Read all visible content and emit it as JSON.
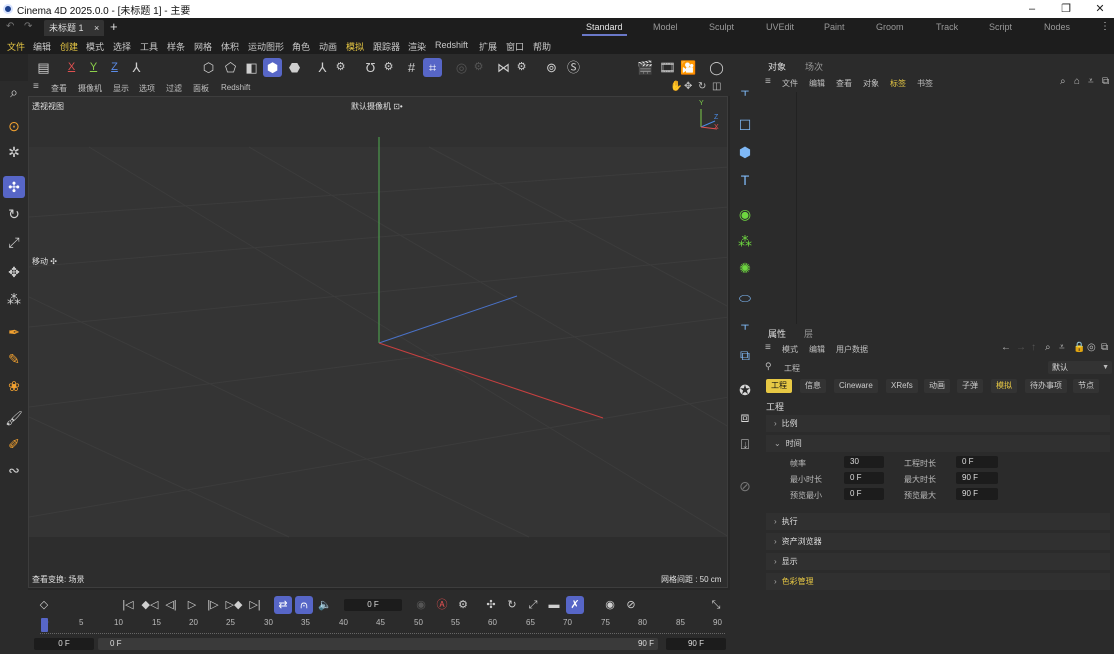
{
  "window": {
    "title": "Cinema 4D 2025.0.0 - [未标题 1] - 主要",
    "minimize": "–",
    "maximize": "❐",
    "close": "✕"
  },
  "tabs": {
    "doc_tab": "未标题 1",
    "close": "×",
    "add": "+"
  },
  "layouts": [
    "Standard",
    "Model",
    "Sculpt",
    "UVEdit",
    "Paint",
    "Groom",
    "Track",
    "Script",
    "Nodes"
  ],
  "active_layout": "Standard",
  "menu": [
    "文件",
    "编辑",
    "创建",
    "模式",
    "选择",
    "工具",
    "样条",
    "网格",
    "体积",
    "运动图形",
    "角色",
    "动画",
    "模拟",
    "跟踪器",
    "渲染",
    "Redshift",
    "扩展",
    "窗口",
    "帮助"
  ],
  "toolbar": {
    "axis_x": "X",
    "axis_y": "Y",
    "axis_z": "Z"
  },
  "viewport": {
    "menu": [
      "查看",
      "摄像机",
      "显示",
      "选项",
      "过滤",
      "面板",
      "Redshift"
    ],
    "label": "透视视图",
    "camera": "默认摄像机 ⊡•",
    "move_label": "移动 ✣",
    "bottom_left": "查看变换: 场景",
    "bottom_right": "网格间距 : 50 cm",
    "axis_y": "Y",
    "axis_z": "Z",
    "axis_x": "X"
  },
  "timeline": {
    "current_frame": "0 F",
    "start_field": "0 F",
    "range_start": "0 F",
    "range_end": "90 F",
    "end_field": "90 F",
    "ruler": [
      "0",
      "5",
      "10",
      "15",
      "20",
      "25",
      "30",
      "35",
      "40",
      "45",
      "50",
      "55",
      "60",
      "65",
      "70",
      "75",
      "80",
      "85",
      "90"
    ]
  },
  "object_panel": {
    "tabs": [
      "对象",
      "场次"
    ],
    "menu": [
      "文件",
      "编辑",
      "查看",
      "对象",
      "标签",
      "书签"
    ]
  },
  "attributes": {
    "tabs": [
      "属性",
      "层"
    ],
    "menu": [
      "模式",
      "编辑",
      "用户数据"
    ],
    "object_name": "工程",
    "preset": "默认",
    "subtabs": [
      "工程",
      "信息",
      "Cineware",
      "XRefs",
      "动画",
      "子弹",
      "模拟",
      "待办事项",
      "节点"
    ],
    "section_heading": "工程",
    "sections": {
      "scale": "比例",
      "time": "时间",
      "execute": "执行",
      "asset_browser": "资产浏览器",
      "display": "显示",
      "color_mgmt": "色彩管理"
    },
    "fields": {
      "fps_label": "帧率",
      "fps": "30",
      "project_time_label": "工程时长",
      "project_time": "0 F",
      "min_time_label": "最小时长",
      "min_time": "0 F",
      "max_time_label": "最大时长",
      "max_time": "90 F",
      "preview_min_label": "预览最小",
      "preview_min": "0 F",
      "preview_max_label": "预览最大",
      "preview_max": "90 F"
    }
  },
  "colors": {
    "accent": "#5766c7",
    "highlight": "#e7c844"
  }
}
